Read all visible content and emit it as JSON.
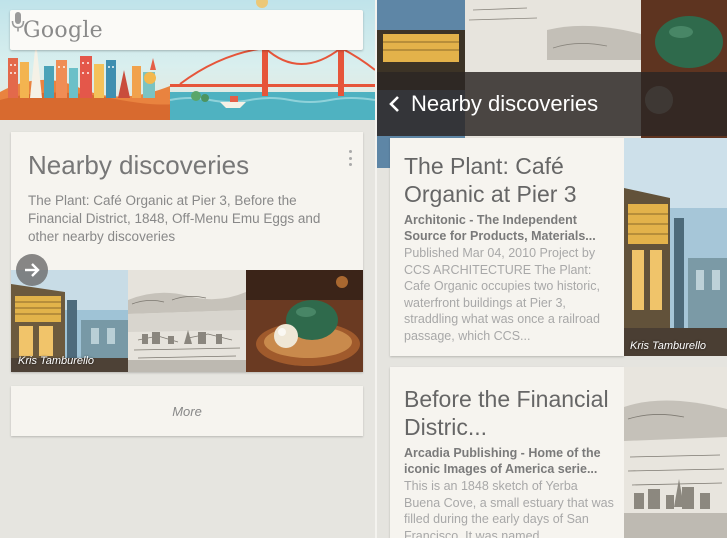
{
  "left": {
    "search": {
      "logo_text": "Google",
      "mic_icon": "mic-icon"
    },
    "nearby_card": {
      "title": "Nearby discoveries",
      "description": "The Plant: Café Organic at Pier 3, Before the Financial District, 1848, Off-Menu Emu Eggs and other nearby discoveries",
      "menu_icon": "overflow-menu-icon",
      "arrow_icon": "arrow-right-icon",
      "thumbnails": [
        {
          "credit": "Kris Tamburello"
        },
        {
          "credit": ""
        },
        {
          "credit": ""
        }
      ]
    },
    "more_card": {
      "label": "More"
    }
  },
  "right": {
    "header": {
      "back_icon": "chevron-left-icon",
      "title": "Nearby discoveries"
    },
    "results": [
      {
        "title": "The Plant: Café Organic at Pier 3",
        "source": "Architonic - The Independent Source for Products, Materials...",
        "snippet": "Published Mar 04, 2010 Project by CCS ARCHITECTURE The Plant: Cafe Organic occupies two historic, waterfront buildings at Pier 3, straddling what was once a railroad passage, which CCS...",
        "photo_credit": "Kris Tamburello"
      },
      {
        "title": "Before the Financial Distric...",
        "source": "Arcadia Publishing - Home of the iconic Images of America serie...",
        "snippet": "This is an 1848 sketch of Yerba Buena Cove, a small estuary that was filled during the early days of San Francisco. It was named",
        "photo_credit": ""
      }
    ]
  },
  "colors": {
    "card_bg": "#f6f4ef",
    "header_overlay": "#2c2624",
    "title_text": "#777777",
    "snippet_text": "#a8a8a8"
  }
}
